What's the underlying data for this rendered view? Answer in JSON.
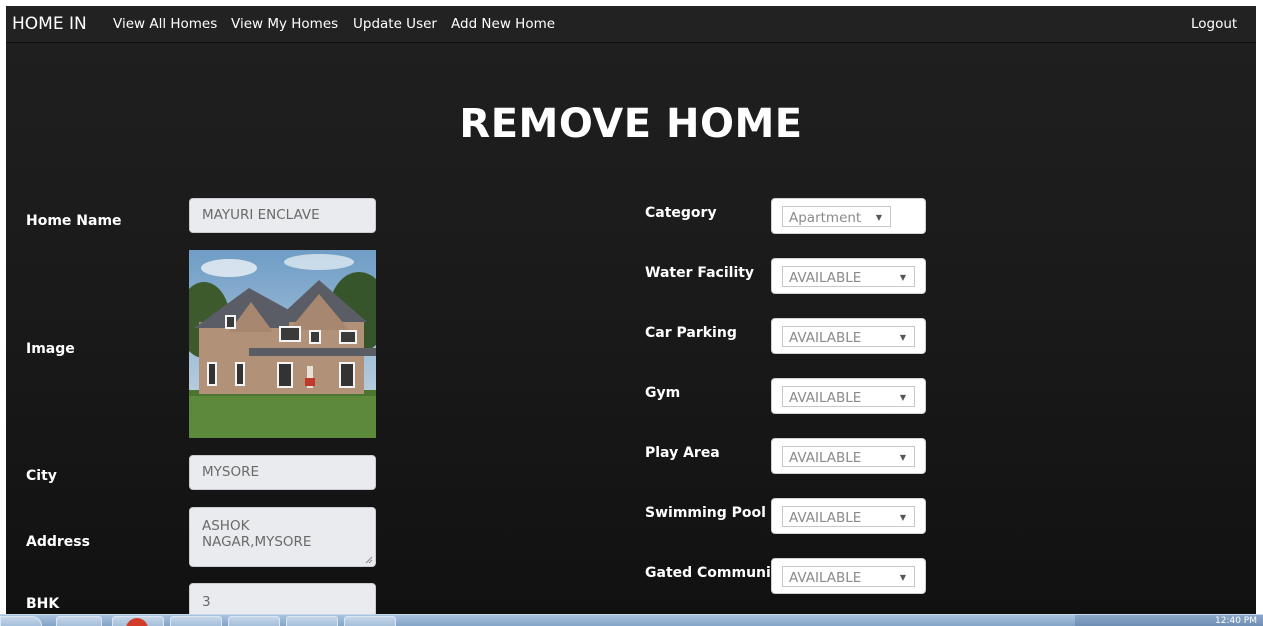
{
  "navbar": {
    "brand": "HOME IN",
    "links": [
      "View All Homes",
      "View My Homes",
      "Update User",
      "Add New Home"
    ],
    "logout": "Logout"
  },
  "page": {
    "title": "REMOVE HOME"
  },
  "left_form": {
    "home_name_label": "Home Name",
    "home_name_value": "MAYURI ENCLAVE",
    "image_label": "Image",
    "city_label": "City",
    "city_value": "MYSORE",
    "address_label": "Address",
    "address_value": "ASHOK NAGAR,MYSORE",
    "bhk_label": "BHK",
    "bhk_value": "3"
  },
  "right_form": {
    "fields": [
      {
        "label": "Category",
        "value": "Apartment"
      },
      {
        "label": "Water Facility",
        "value": "AVAILABLE"
      },
      {
        "label": "Car Parking",
        "value": "AVAILABLE"
      },
      {
        "label": "Gym",
        "value": "AVAILABLE"
      },
      {
        "label": "Play Area",
        "value": "AVAILABLE"
      },
      {
        "label": "Swimming Pool",
        "value": "AVAILABLE"
      },
      {
        "label": "Gated Community",
        "value": "AVAILABLE"
      }
    ]
  },
  "taskbar": {
    "clock": "12:40 PM"
  },
  "colors": {
    "navbar_bg": "#222222",
    "content_bg": "#1a1a1a",
    "text": "#ffffff",
    "field_bg": "#e9ebee"
  }
}
